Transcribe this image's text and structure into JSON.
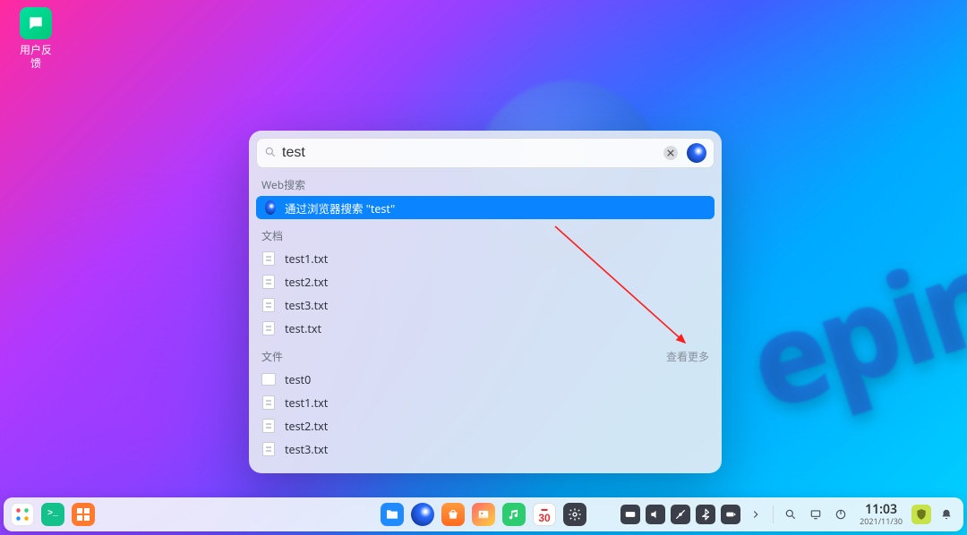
{
  "desktop": {
    "feedback_label": "用户反\n馈"
  },
  "bg_logo_text": "epin",
  "search": {
    "query": "test",
    "placeholder": ""
  },
  "sections": {
    "web_label": "Web搜索",
    "web_result": "通过浏览器搜索 \"test\"",
    "docs_label": "文档",
    "docs": [
      "test1.txt",
      "test2.txt",
      "test3.txt",
      "test.txt"
    ],
    "files_label": "文件",
    "files_more": "查看更多",
    "files": [
      "test0",
      "test1.txt",
      "test2.txt",
      "test3.txt"
    ]
  },
  "calendar_day": "30",
  "clock": {
    "time": "11:03",
    "date": "2021/11/30"
  }
}
